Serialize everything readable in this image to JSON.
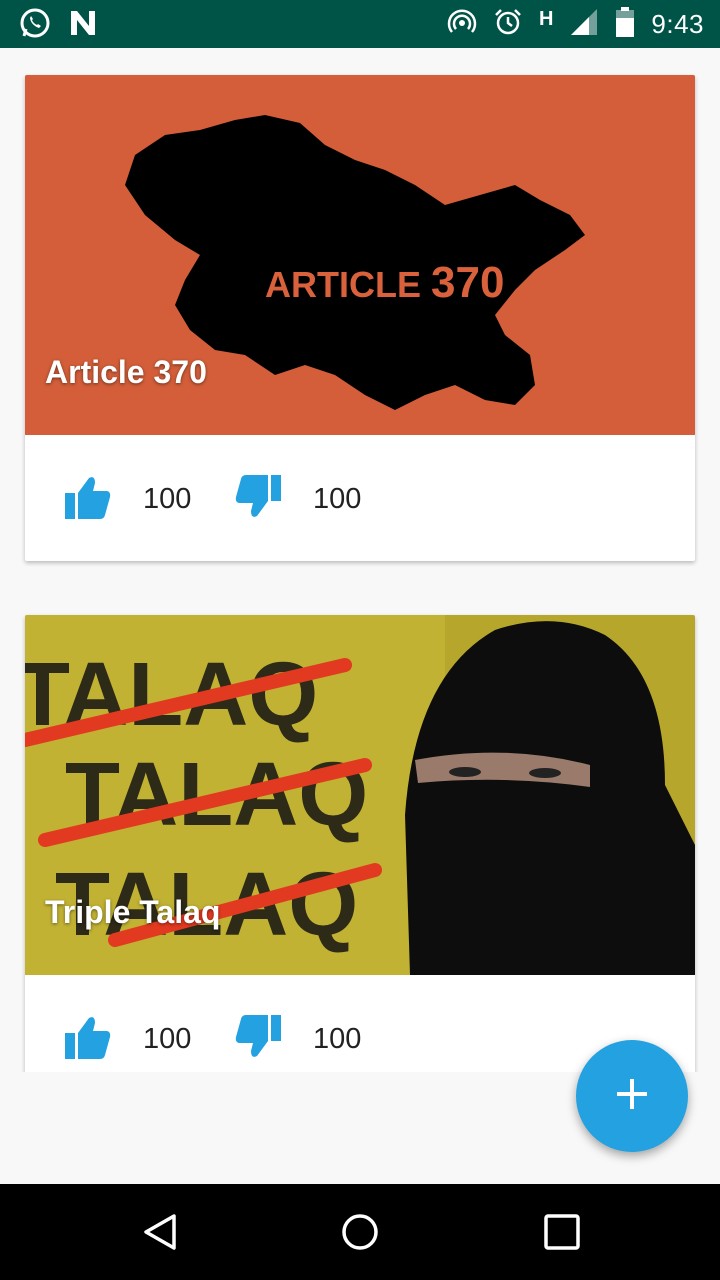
{
  "status_bar": {
    "time": "9:43",
    "network_type": "H",
    "left_icons": [
      "whatsapp-icon",
      "n-notification-icon"
    ],
    "right_icons": [
      "hotspot-icon",
      "alarm-icon",
      "signal-icon",
      "battery-icon"
    ]
  },
  "cards": [
    {
      "title": "Article 370",
      "image_caption": "ARTICLE 370",
      "likes": "100",
      "dislikes": "100"
    },
    {
      "title": "Triple Talaq",
      "image_caption": "TALAQ",
      "likes": "100",
      "dislikes": "100"
    }
  ],
  "fab": {
    "icon": "plus-icon"
  },
  "nav_bar": {
    "icons": [
      "back-icon",
      "home-icon",
      "recents-icon"
    ]
  },
  "colors": {
    "status_bar": "#005347",
    "accent": "#24a1e0",
    "card_bg": "#ffffff",
    "page_bg": "#f8f8f8"
  }
}
